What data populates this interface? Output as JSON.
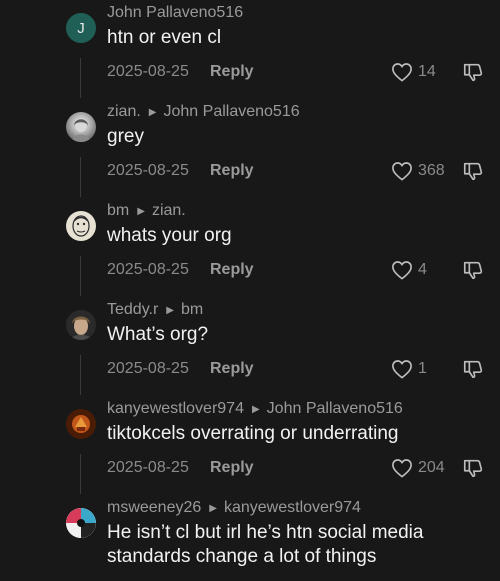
{
  "comments": [
    {
      "avatar_letter": "J",
      "avatar_color": "#1f5f55",
      "username": "John Pallaveno516",
      "reply_to": "",
      "text": "htn or even cl",
      "date": "2025-08-25",
      "reply_label": "Reply",
      "likes": "14"
    },
    {
      "avatar_letter": "",
      "avatar_color": "#9a9a9a",
      "username": "zian.",
      "reply_to": "John Pallaveno516",
      "text": "grey",
      "date": "2025-08-25",
      "reply_label": "Reply",
      "likes": "368"
    },
    {
      "avatar_letter": "",
      "avatar_color": "#d8d4c8",
      "username": "bm",
      "reply_to": "zian.",
      "text": "whats your org",
      "date": "2025-08-25",
      "reply_label": "Reply",
      "likes": "4"
    },
    {
      "avatar_letter": "",
      "avatar_color": "#8a7a5a",
      "username": "Teddy.r",
      "reply_to": "bm",
      "text": "What’s org?",
      "date": "2025-08-25",
      "reply_label": "Reply",
      "likes": "1"
    },
    {
      "avatar_letter": "",
      "avatar_color": "#8a3a10",
      "username": "kanyewestlover974",
      "reply_to": "John Pallaveno516",
      "text": "tiktokcels overrating or underrating",
      "date": "2025-08-25",
      "reply_label": "Reply",
      "likes": "204"
    },
    {
      "avatar_letter": "",
      "avatar_color": "#3aa8c8",
      "username": "msweeney26",
      "reply_to": "kanyewestlover974",
      "text": "He isn’t cl but irl he’s htn social media standards change a lot of things",
      "date": "",
      "reply_label": "",
      "likes": ""
    }
  ]
}
